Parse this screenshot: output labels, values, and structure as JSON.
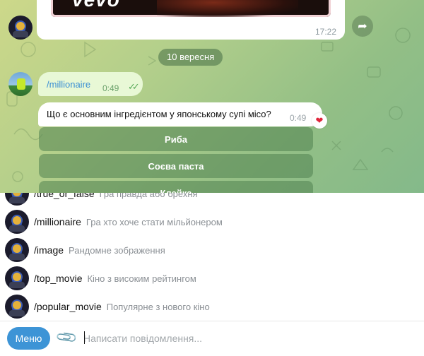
{
  "chat": {
    "previous_message": {
      "video_logo": "vevo",
      "time": "17:22"
    },
    "date_divider": "10 вересня",
    "command_message": {
      "text": "/millionaire",
      "time": "0:49",
      "status_icon": "double-check-icon"
    },
    "question_message": {
      "text": "Що є основним інгредієнтом у японському супі місо?",
      "time": "0:49",
      "reaction": "❤"
    },
    "answer_buttons": [
      "Риба",
      "Соєва паста",
      "Клейка"
    ]
  },
  "command_suggestions": [
    {
      "command": "/true_or_false",
      "description": "Гра правда або брехня"
    },
    {
      "command": "/millionaire",
      "description": "Гра хто хоче стати мільйонером"
    },
    {
      "command": "/image",
      "description": "Рандомне зображення"
    },
    {
      "command": "/top_movie",
      "description": "Кіно з високим рейтингом"
    },
    {
      "command": "/popular_movie",
      "description": "Популярне з нового кіно"
    }
  ],
  "composer": {
    "menu_label": "Меню",
    "placeholder": "Написати повідомлення..."
  },
  "colors": {
    "accent": "#3d94d6",
    "link": "#3a8fd4"
  }
}
